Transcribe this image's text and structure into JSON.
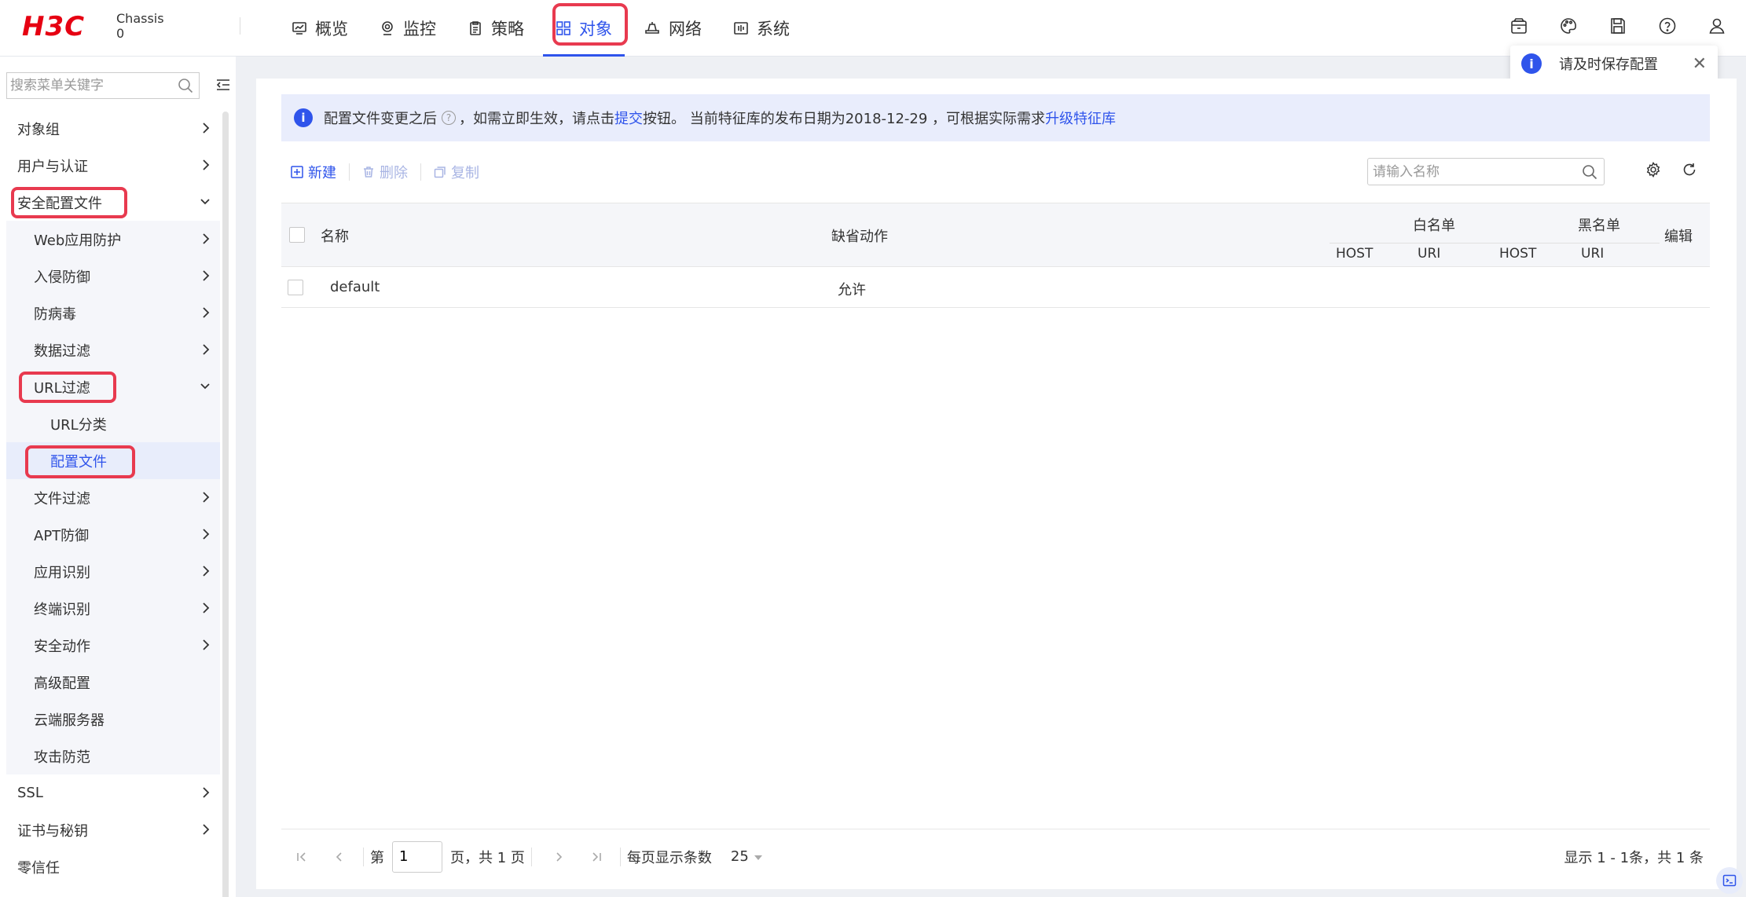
{
  "header": {
    "logo": "H3C",
    "chassis_line1": "Chassis",
    "chassis_line2": "0",
    "nav": [
      {
        "label": "概览",
        "icon": "dashboard-icon"
      },
      {
        "label": "监控",
        "icon": "monitor-icon"
      },
      {
        "label": "策略",
        "icon": "policy-icon"
      },
      {
        "label": "对象",
        "icon": "object-grid-icon",
        "active": true
      },
      {
        "label": "网络",
        "icon": "network-icon"
      },
      {
        "label": "系统",
        "icon": "system-icon"
      }
    ],
    "tools": [
      "package-icon",
      "palette-icon",
      "save-icon",
      "help-icon",
      "user-icon"
    ]
  },
  "toast": {
    "message": "请及时保存配置"
  },
  "sidebar": {
    "search_placeholder": "搜索菜单关键字",
    "items": [
      {
        "label": "对象组",
        "level": 1
      },
      {
        "label": "用户与认证",
        "level": 1
      },
      {
        "label": "安全配置文件",
        "level": 1,
        "expanded": true
      },
      {
        "label": "Web应用防护",
        "level": 2
      },
      {
        "label": "入侵防御",
        "level": 2
      },
      {
        "label": "防病毒",
        "level": 2
      },
      {
        "label": "数据过滤",
        "level": 2
      },
      {
        "label": "URL过滤",
        "level": 2,
        "expanded": true
      },
      {
        "label": "URL分类",
        "level": 3
      },
      {
        "label": "配置文件",
        "level": 3,
        "selected": true
      },
      {
        "label": "文件过滤",
        "level": 2
      },
      {
        "label": "APT防御",
        "level": 2
      },
      {
        "label": "应用识别",
        "level": 2
      },
      {
        "label": "终端识别",
        "level": 2
      },
      {
        "label": "安全动作",
        "level": 2
      },
      {
        "label": "高级配置",
        "level": 2
      },
      {
        "label": "云端服务器",
        "level": 2
      },
      {
        "label": "攻击防范",
        "level": 2
      },
      {
        "label": "SSL",
        "level": 1
      },
      {
        "label": "证书与秘钥",
        "level": 1
      },
      {
        "label": "零信任",
        "level": 1
      }
    ]
  },
  "banner": {
    "part1": "配置文件变更之后",
    "part2": "，如需立即生效，请点击",
    "link_submit": "提交",
    "part3": "按钮。  当前特征库的发布日期为2018-12-29 ，可根据实际需求",
    "link_upgrade": "升级特征库"
  },
  "toolbar": {
    "new_label": "新建",
    "delete_label": "删除",
    "copy_label": "复制",
    "search_placeholder": "请输入名称"
  },
  "table": {
    "headers": {
      "name": "名称",
      "default_action": "缺省动作",
      "whitelist": "白名单",
      "blacklist": "黑名单",
      "edit": "编辑",
      "host": "HOST",
      "uri": "URI"
    },
    "rows": [
      {
        "name": "default",
        "default_action": "允许"
      }
    ]
  },
  "pager": {
    "page_prefix": "第",
    "page_value": "1",
    "page_suffix": "页，共 1 页",
    "per_page_label": "每页显示条数",
    "per_page_value": "25",
    "total": "显示 1 - 1条，共 1 条"
  }
}
